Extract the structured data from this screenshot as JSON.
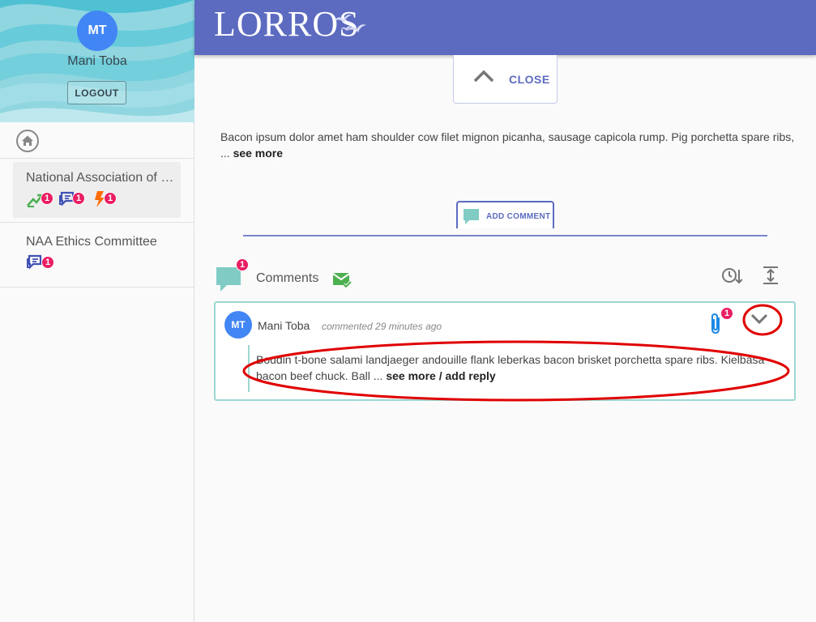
{
  "user": {
    "initials": "MT",
    "name": "Mani Toba",
    "logout_label": "LOGOUT"
  },
  "sidebar": {
    "items": [
      {
        "label": "National Association of Realtors",
        "badges": [
          "1",
          "1",
          "1"
        ]
      },
      {
        "label": "NAA Ethics Committee",
        "badges": [
          "1"
        ]
      }
    ]
  },
  "header": {
    "logo_text": "LORROS"
  },
  "main": {
    "close_label": "CLOSE",
    "description": "Bacon ipsum dolor amet ham shoulder cow filet mignon picanha, sausage capicola rump. Pig porchetta spare ribs, ...",
    "see_more": "see more",
    "add_comment_label": "ADD COMMENT",
    "comments_label": "Comments",
    "comments_count": "1"
  },
  "comment": {
    "initials": "MT",
    "author": "Mani Toba",
    "time": "commented 29 minutes ago",
    "attachment_count": "1",
    "text": "Boudin t-bone salami landjaeger andouille flank leberkas bacon brisket porchetta spare ribs. Kielbasa bacon beef chuck. Ball ...",
    "see_more_reply": "see more / add reply"
  },
  "colors": {
    "accent": "#5c6bc0",
    "badge": "#e91e63",
    "teal": "#80cbc4",
    "avatar": "#4285f4",
    "annotation": "#e00000"
  }
}
